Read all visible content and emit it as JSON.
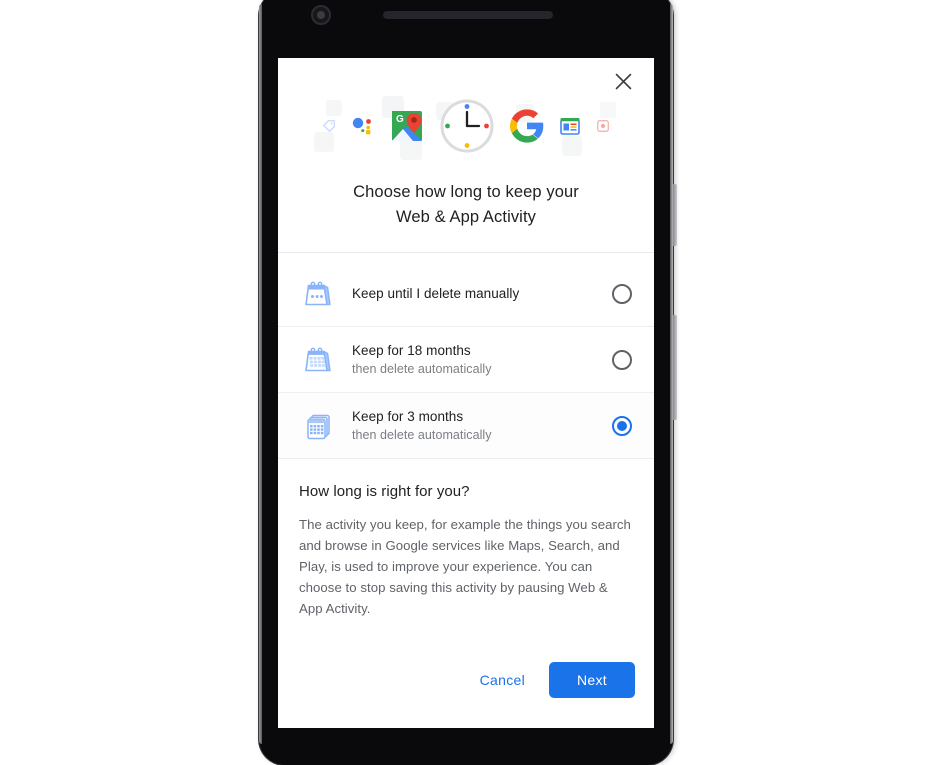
{
  "device": {
    "name": "android-phone-mockup",
    "camera": "front-camera",
    "speaker": "earpiece-speaker-grille",
    "volume_button": "volume-rocker",
    "power_button": "power-button"
  },
  "dialog": {
    "close_label": "×",
    "title": "Choose how long to keep your Web & App Activity",
    "title_line1": "Choose how long to keep your",
    "title_line2": "Web & App Activity",
    "hero_icons": [
      "tag-icon",
      "assistant-dots-icon",
      "google-maps-icon",
      "clock-icon",
      "google-g-icon",
      "google-news-icon",
      "google-photos-small-icon"
    ]
  },
  "options": [
    {
      "id": "keep-until-manual",
      "icon": "calendar-dots-icon",
      "title": "Keep until I delete manually",
      "subtitle": "",
      "selected": false
    },
    {
      "id": "keep-18-months",
      "icon": "calendar-grid-icon",
      "title": "Keep for 18 months",
      "subtitle": "then delete automatically",
      "selected": false
    },
    {
      "id": "keep-3-months",
      "icon": "calendar-stack-icon",
      "title": "Keep for 3 months",
      "subtitle": "then delete automatically",
      "selected": true
    }
  ],
  "info": {
    "heading": "How long is right for you?",
    "body": "The activity you keep, for example the things you search and browse in Google services like Maps, Search, and Play, is used to improve your experience. You can choose to stop saving this activity by pausing Web & App Activity."
  },
  "footer": {
    "cancel_label": "Cancel",
    "next_label": "Next"
  },
  "colors": {
    "accent": "#1a73e8",
    "text_primary": "#202124",
    "text_secondary": "#5f6368",
    "divider": "#e8eaed",
    "card_background": "#ffffff",
    "device_body": "#0a0a0c",
    "page_background": "#ffffff"
  }
}
